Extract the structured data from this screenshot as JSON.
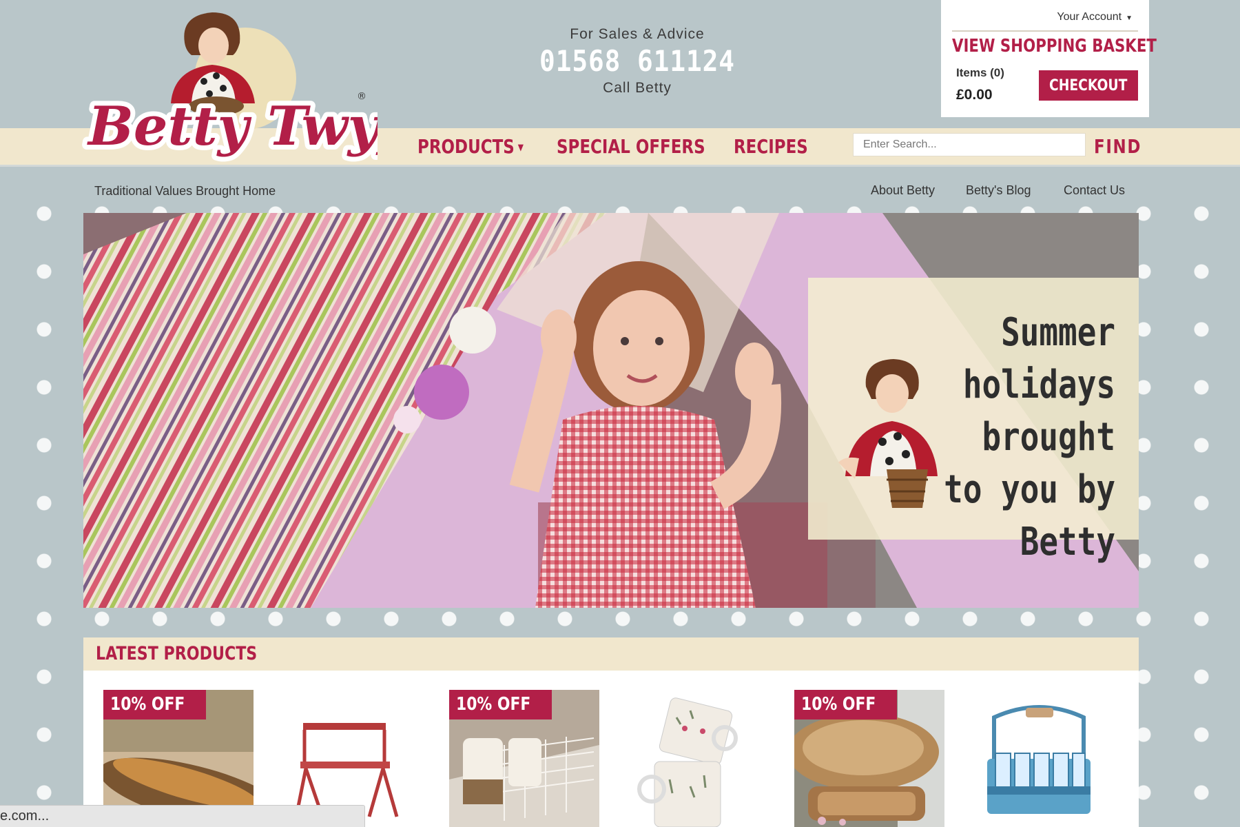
{
  "brand": {
    "name": "Betty Twyford"
  },
  "contact": {
    "label": "For Sales & Advice",
    "phone": "01568 611124",
    "call": "Call Betty"
  },
  "account": {
    "your_account": "Your Account",
    "view_basket": "VIEW SHOPPING BASKET",
    "items": "Items (0)",
    "total": "£0.00",
    "checkout": "CHECKOUT"
  },
  "nav": {
    "products": "PRODUCTS",
    "special_offers": "SPECIAL OFFERS",
    "recipes": "RECIPES"
  },
  "search": {
    "placeholder": "Enter Search...",
    "button": "FIND"
  },
  "tagline": "Traditional Values Brought Home",
  "sublinks": {
    "about": "About Betty",
    "blog": "Betty's Blog",
    "contact": "Contact Us"
  },
  "hero": {
    "promo_text": "Summer holidays\nbrought\nto you by\nBetty"
  },
  "latest": {
    "title": "LATEST PRODUCTS",
    "products": [
      {
        "badge": "10% OFF"
      },
      {
        "badge": ""
      },
      {
        "badge": "10% OFF"
      },
      {
        "badge": ""
      },
      {
        "badge": "10% OFF"
      },
      {
        "badge": ""
      }
    ]
  },
  "status": {
    "text": "e.com..."
  },
  "colors": {
    "accent": "#b21f48",
    "band": "#f1e7cd",
    "background": "#b9c6c9"
  }
}
